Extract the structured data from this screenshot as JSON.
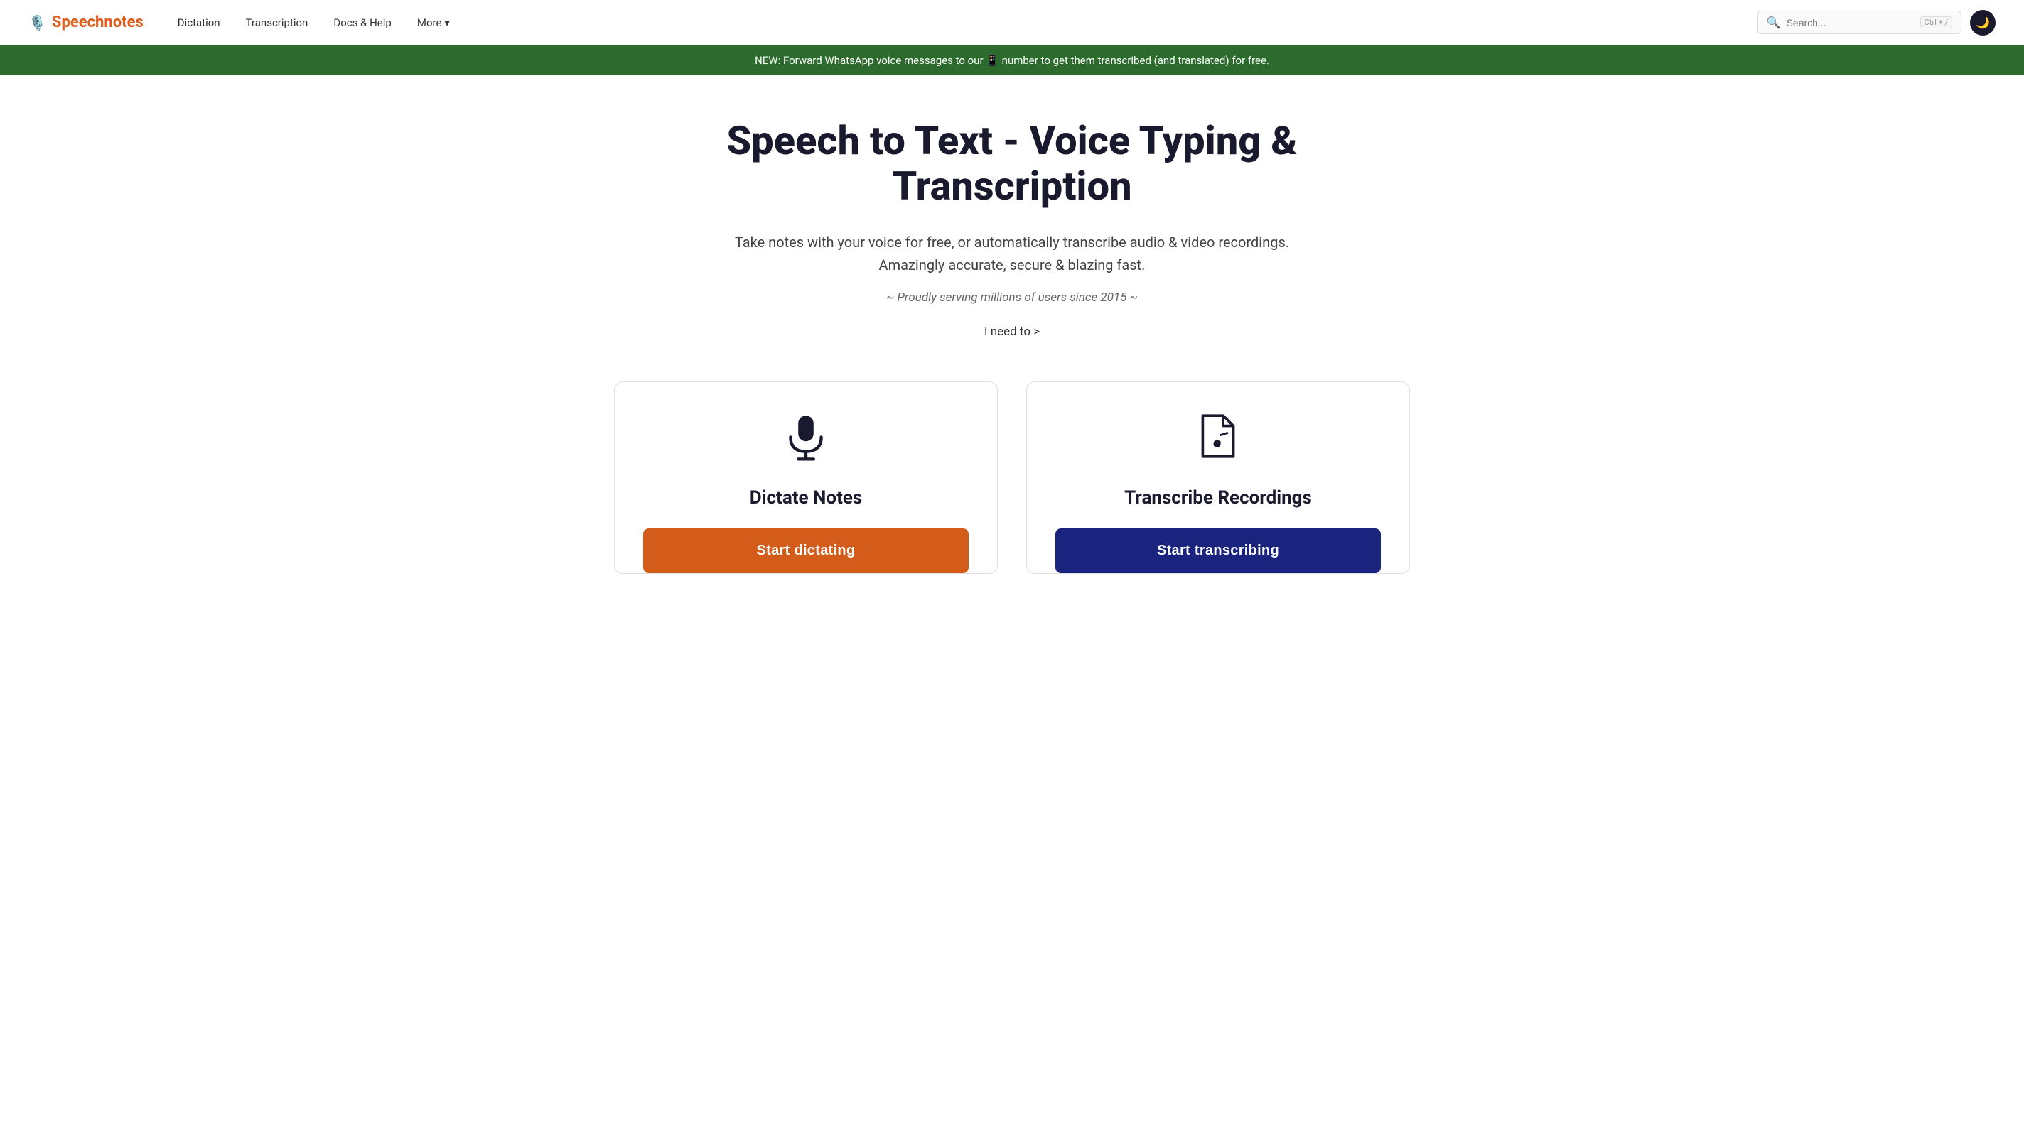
{
  "nav": {
    "logo_icon": "🎙️",
    "logo_text": "Speechnotes",
    "links": [
      {
        "label": "Dictation",
        "id": "dictation"
      },
      {
        "label": "Transcription",
        "id": "transcription"
      },
      {
        "label": "Docs & Help",
        "id": "docs-help"
      },
      {
        "label": "More",
        "id": "more",
        "has_chevron": true
      }
    ],
    "search_placeholder": "Search...",
    "search_shortcut": "Ctrl + /",
    "theme_icon": "🌙"
  },
  "banner": {
    "text": "NEW: Forward WhatsApp voice messages to our 📱 number to get them transcribed (and translated) for free."
  },
  "hero": {
    "title": "Speech to Text - Voice Typing & Transcription",
    "subtitle": "Take notes with your voice for free, or automatically transcribe audio & video recordings.\nAmazingly accurate, secure & blazing fast.",
    "tagline": "~ Proudly serving millions of users since 2015 ~",
    "cta": "I need to >"
  },
  "cards": [
    {
      "id": "dictate",
      "title": "Dictate Notes",
      "button_label": "Start dictating",
      "button_type": "dictate"
    },
    {
      "id": "transcribe",
      "title": "Transcribe Recordings",
      "button_label": "Start transcribing",
      "button_type": "transcribe"
    }
  ]
}
